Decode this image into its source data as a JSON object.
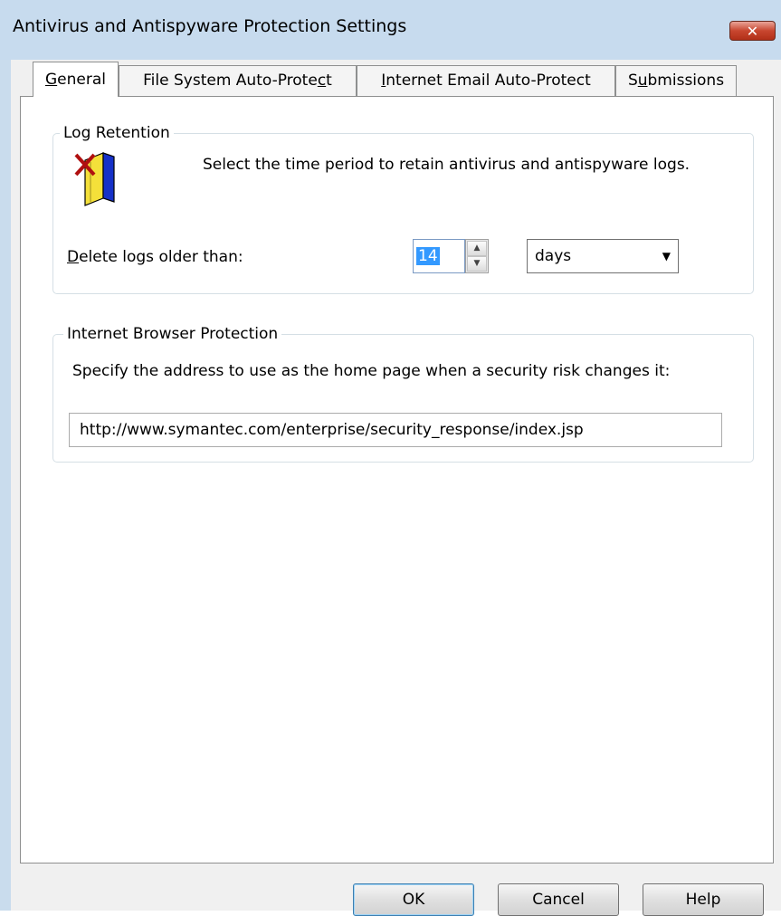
{
  "window": {
    "title": "Antivirus and Antispyware Protection Settings",
    "close_glyph": "✕"
  },
  "tabs": [
    {
      "pre": "",
      "key": "G",
      "post": "eneral"
    },
    {
      "pre": "File System Auto-Prote",
      "key": "c",
      "post": "t"
    },
    {
      "pre": "",
      "key": "I",
      "post": "nternet Email Auto-Protect"
    },
    {
      "pre": "S",
      "key": "u",
      "post": "bmissions"
    }
  ],
  "log_retention": {
    "legend": "Log Retention",
    "icon": "log-book-delete-icon",
    "description": "Select the time period to retain antivirus and antispyware logs.",
    "delete_label_key": "D",
    "delete_label_rest": "elete logs older than:",
    "days_value": "14",
    "unit_value": "days",
    "up_glyph": "▲",
    "down_glyph": "▼",
    "dropdown_glyph": "▼"
  },
  "browser_protection": {
    "legend": "Internet Browser Protection",
    "description": "Specify the address to use as the home page when a security risk changes it:",
    "home_page_url": "http://www.symantec.com/enterprise/security_response/index.jsp"
  },
  "buttons": {
    "ok": "OK",
    "cancel": "Cancel",
    "help": "Help"
  }
}
